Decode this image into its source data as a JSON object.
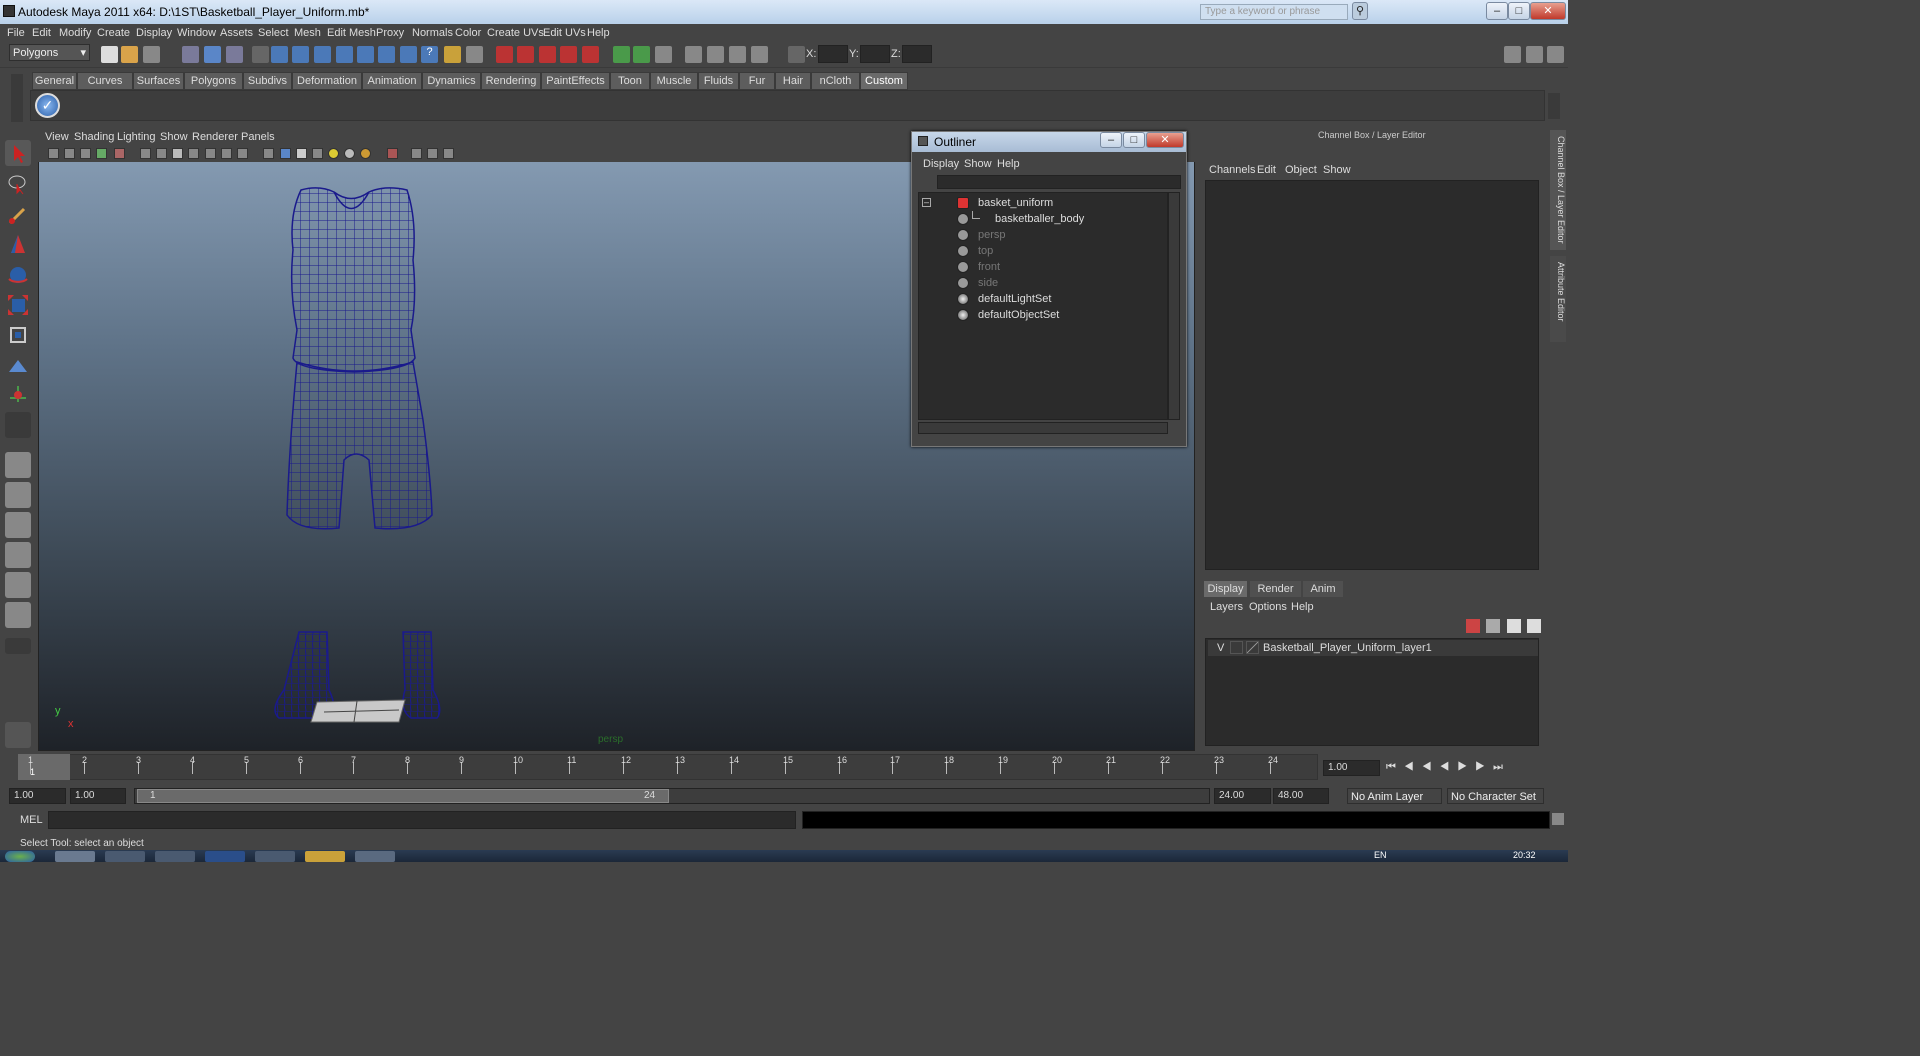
{
  "window": {
    "title": "Autodesk Maya 2011 x64: D:\\1ST\\Basketball_Player_Uniform.mb*",
    "search_placeholder": "Type a keyword or phrase"
  },
  "menubar": [
    "File",
    "Edit",
    "Modify",
    "Create",
    "Display",
    "Window",
    "Assets",
    "Select",
    "Mesh",
    "Edit Mesh",
    "Proxy",
    "Normals",
    "Color",
    "Create UVs",
    "Edit UVs",
    "Help"
  ],
  "status": {
    "mode": "Polygons",
    "x_label": "X:",
    "y_label": "Y:",
    "z_label": "Z:"
  },
  "shelf_tabs": [
    "General",
    "Curves",
    "Surfaces",
    "Polygons",
    "Subdivs",
    "Deformation",
    "Animation",
    "Dynamics",
    "Rendering",
    "PaintEffects",
    "Toon",
    "Muscle",
    "Fluids",
    "Fur",
    "Hair",
    "nCloth",
    "Custom"
  ],
  "shelf_active": "Custom",
  "viewport": {
    "menus": [
      "View",
      "Shading",
      "Lighting",
      "Show",
      "Renderer",
      "Panels"
    ],
    "camera_label": "persp",
    "axis_y": "y",
    "axis_x": "x"
  },
  "outliner": {
    "title": "Outliner",
    "menus": [
      "Display",
      "Show",
      "Help"
    ],
    "items": [
      {
        "label": "basket_uniform",
        "dim": false
      },
      {
        "label": "basketballer_body",
        "dim": false
      },
      {
        "label": "persp",
        "dim": true
      },
      {
        "label": "top",
        "dim": true
      },
      {
        "label": "front",
        "dim": true
      },
      {
        "label": "side",
        "dim": true
      },
      {
        "label": "defaultLightSet",
        "dim": false
      },
      {
        "label": "defaultObjectSet",
        "dim": false
      }
    ]
  },
  "channel_box": {
    "title": "Channel Box / Layer Editor",
    "menus": [
      "Channels",
      "Edit",
      "Object",
      "Show"
    ],
    "side_tabs": [
      "Channel Box / Layer Editor",
      "Attribute Editor"
    ]
  },
  "layer_editor": {
    "tabs": [
      "Display",
      "Render",
      "Anim"
    ],
    "active_tab": "Display",
    "menus": [
      "Layers",
      "Options",
      "Help"
    ],
    "layer": {
      "visible": "V",
      "name": "Basketball_Player_Uniform_layer1"
    }
  },
  "time_slider": {
    "ticks": [
      "1",
      "2",
      "3",
      "4",
      "5",
      "6",
      "7",
      "8",
      "9",
      "10",
      "11",
      "12",
      "13",
      "14",
      "15",
      "16",
      "17",
      "18",
      "19",
      "20",
      "21",
      "22",
      "23",
      "24"
    ],
    "current_frame": "1",
    "current_field": "1.00"
  },
  "range_slider": {
    "start": "1.00",
    "start2": "1.00",
    "range_start": "1",
    "range_end": "24",
    "end": "24.00",
    "end2": "48.00",
    "anim_layer": "No Anim Layer",
    "char_set": "No Character Set"
  },
  "command_line": {
    "label": "MEL"
  },
  "help_line": "Select Tool: select an object",
  "taskbar": {
    "lang": "EN",
    "time": "20:32"
  },
  "colors": {
    "wire": "#1a1a8c",
    "title_bar": "#c7d7ea",
    "active_tab": "#6a6a6a"
  }
}
